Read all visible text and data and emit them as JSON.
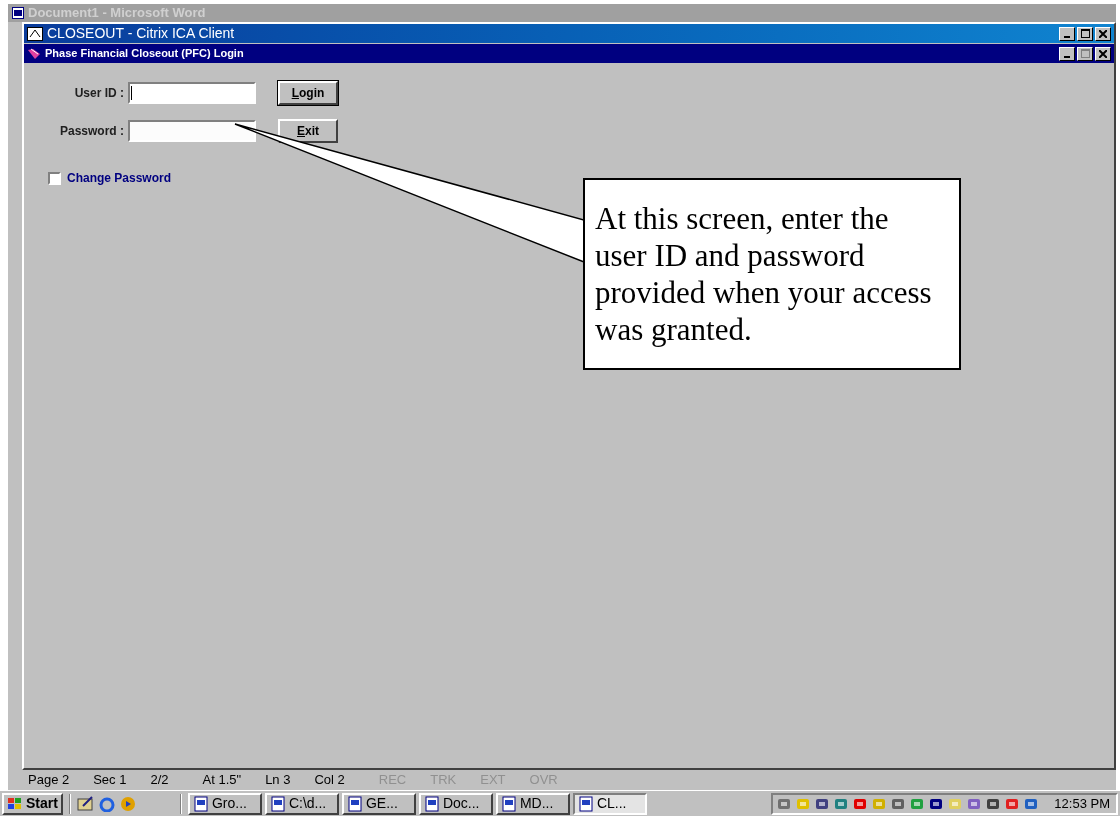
{
  "background_window": {
    "title": "Document1 - Microsoft Word",
    "status_bar": [
      "Page 2",
      "Sec 1",
      "2/2",
      "At 1.5\"",
      "Ln 3",
      "Col 2",
      "REC",
      "TRK",
      "EXT",
      "OVR"
    ]
  },
  "window": {
    "title": "CLOSEOUT - Citrix ICA Client"
  },
  "dialog": {
    "title": "Phase Financial Closeout (PFC) Login",
    "fields": [
      {
        "label": "User ID :",
        "focused": true
      },
      {
        "label": "Password :",
        "focused": false
      }
    ],
    "buttons": [
      {
        "label": "Login",
        "default": true
      },
      {
        "label": "Exit",
        "default": false
      }
    ],
    "change_password": {
      "label": "Change Password",
      "checked": false
    }
  },
  "callout": {
    "text": "At this screen, enter the user ID and password provided when your access was granted."
  },
  "taskbar": {
    "start": "Start",
    "tasks": [
      {
        "label": "Gro...",
        "selected": false
      },
      {
        "label": "C:\\d...",
        "selected": false
      },
      {
        "label": "GE...",
        "selected": false
      },
      {
        "label": "Doc...",
        "selected": false
      },
      {
        "label": "MD...",
        "selected": false
      },
      {
        "label": "CL...",
        "selected": true
      }
    ],
    "clock": "12:53 PM"
  }
}
